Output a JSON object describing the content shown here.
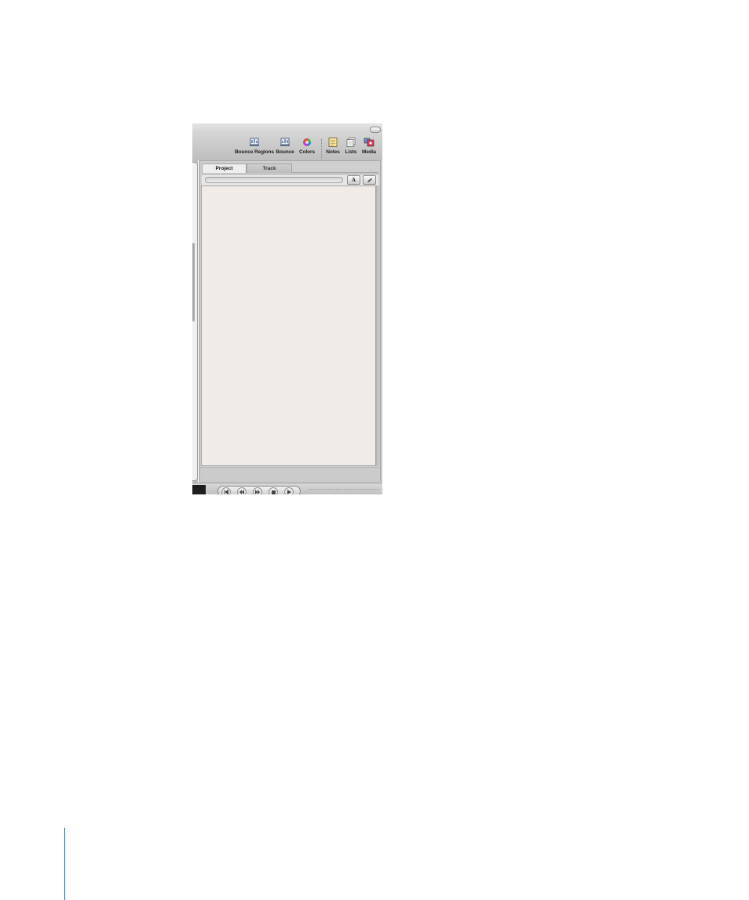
{
  "toolbar": {
    "bounce_regions_label": "Bounce Regions",
    "bounce_label": "Bounce",
    "colors_label": "Colors",
    "notes_label": "Notes",
    "lists_label": "Lists",
    "media_label": "Media"
  },
  "tabs": {
    "project_label": "Project",
    "track_label": "Track"
  },
  "text_toolbar": {
    "font_button_label": "A",
    "edit_button_icon": "pencil-icon"
  },
  "notes": {
    "content": ""
  },
  "colors": {
    "notes_background": "#f0ebe6",
    "window_chrome": "#c9c9c9",
    "page_rule": "#2a5aa0"
  }
}
